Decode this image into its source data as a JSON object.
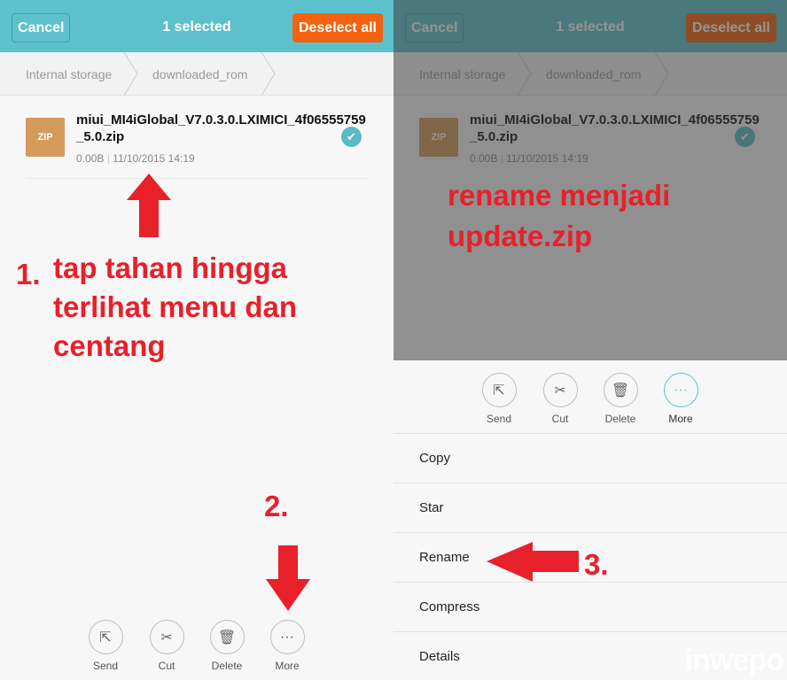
{
  "header": {
    "cancel_label": "Cancel",
    "title": "1 selected",
    "deselect_label": "Deselect all"
  },
  "breadcrumb": [
    "Internal storage",
    "downloaded_rom"
  ],
  "file": {
    "icon_label": "ZIP",
    "name": "miui_MI4iGlobal_V7.0.3.0.LXIMICI_4f06555759_5.0.zip",
    "size": "0.00B",
    "date": "11/10/2015 14:19",
    "selected": true
  },
  "actions": [
    {
      "label": "Send",
      "icon": "share-icon"
    },
    {
      "label": "Cut",
      "icon": "scissors-icon"
    },
    {
      "label": "Delete",
      "icon": "trash-icon"
    },
    {
      "label": "More",
      "icon": "more-dots-icon"
    }
  ],
  "more_menu": [
    "Copy",
    "Star",
    "Rename",
    "Compress",
    "Details"
  ],
  "annotations": {
    "step1_num": "1.",
    "step1_text": "tap tahan hingga terlihat menu dan centang",
    "step2_num": "2.",
    "step3_num": "3.",
    "rename_text": "rename menjadi update.zip"
  },
  "watermark": "inwepo",
  "colors": {
    "header": "#5cc1cd",
    "deselect": "#f2620f",
    "annotation": "#e8202a",
    "zip": "#d49a5c"
  }
}
